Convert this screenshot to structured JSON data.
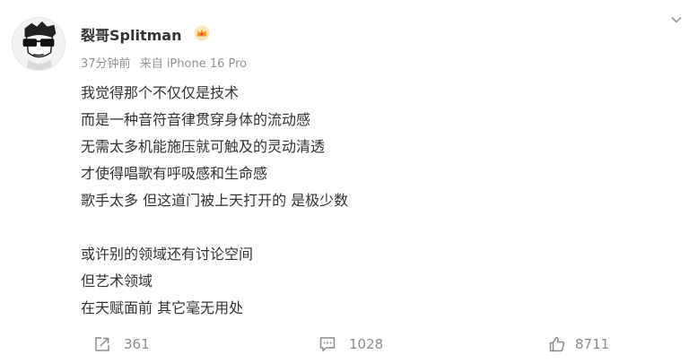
{
  "post": {
    "author": {
      "name": "裂哥Splitman",
      "badge_icon": "crown-badge-icon",
      "badge_color": "#f7a23b"
    },
    "meta": {
      "time": "37分钟前",
      "source": "来自 iPhone 16 Pro"
    },
    "more_icon": "chevron-down-icon",
    "content": {
      "paragraph1": [
        "我觉得那个不仅仅是技术",
        "而是一种音符音律贯穿身体的流动感",
        "无需太多机能施压就可触及的灵动清透",
        "才使得唱歌有呼吸感和生命感",
        "歌手太多 但这道门被上天打开的 是极少数"
      ],
      "paragraph2": [
        "或许别的领域还有讨论空间",
        "但艺术领域",
        "在天赋面前 其它毫无用处"
      ]
    },
    "actions": {
      "repost": {
        "icon": "share-icon",
        "count": "361"
      },
      "comment": {
        "icon": "comment-icon",
        "count": "1028"
      },
      "like": {
        "icon": "thumbs-up-icon",
        "count": "8711"
      }
    }
  }
}
